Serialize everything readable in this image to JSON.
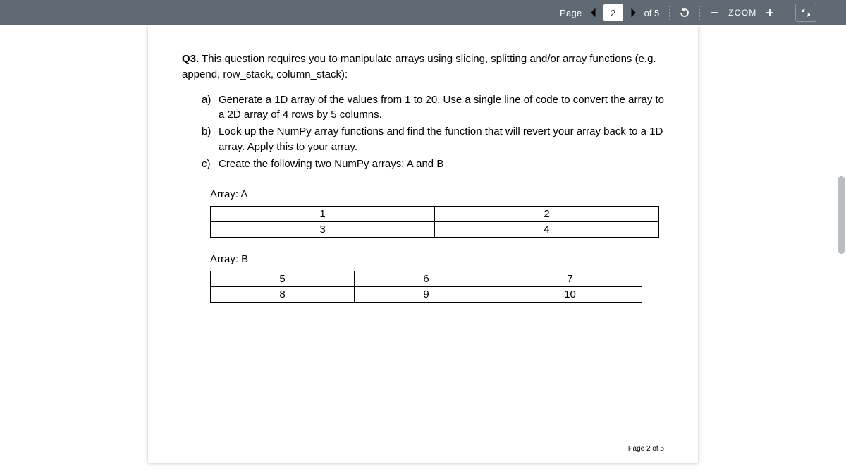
{
  "toolbar": {
    "page_label": "Page",
    "current_page": "2",
    "of_label": "of 5",
    "zoom_label": "ZOOM"
  },
  "question": {
    "number": "Q3.",
    "intro": "This question requires you to manipulate arrays using slicing, splitting and/or array functions (e.g. append, row_stack, column_stack):",
    "parts": [
      {
        "marker": "a)",
        "text": "Generate a 1D array of the values from 1 to 20.   Use a single line of code to convert the array to a 2D array of 4 rows by 5 columns."
      },
      {
        "marker": "b)",
        "text": "Look up the NumPy array functions and find the function that will revert your array back to a 1D array.  Apply this to your array."
      },
      {
        "marker": "c)",
        "text": "Create the following two NumPy arrays: A and B"
      }
    ]
  },
  "arrays": {
    "a_label": "Array:  A",
    "a": [
      [
        "1",
        "2"
      ],
      [
        "3",
        "4"
      ]
    ],
    "b_label": "Array: B",
    "b": [
      [
        "5",
        "6",
        "7"
      ],
      [
        "8",
        "9",
        "10"
      ]
    ]
  },
  "footer": "Page 2 of 5"
}
